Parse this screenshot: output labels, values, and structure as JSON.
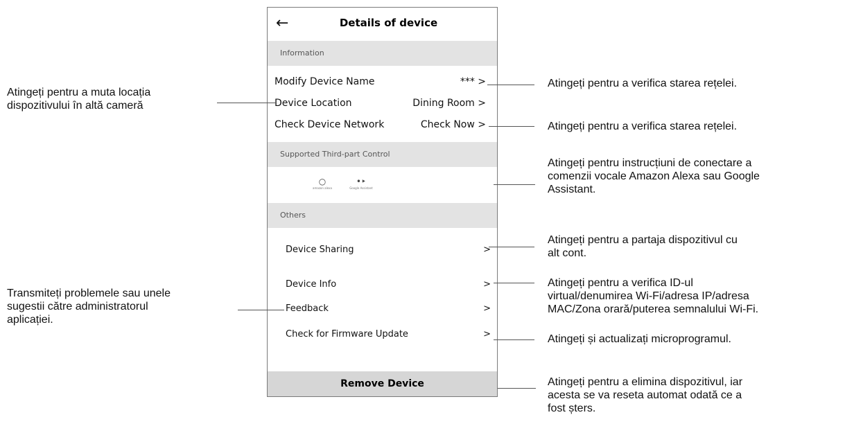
{
  "header": {
    "back_icon": "arrow-left-icon",
    "title": "Details of device"
  },
  "sections": {
    "information": "Information",
    "third_party": "Supported Third-part Control",
    "others": "Others"
  },
  "info_rows": [
    {
      "label": "Modify Device Name",
      "value": "*** >"
    },
    {
      "label": "Device Location",
      "value": "Dining Room >"
    },
    {
      "label": "Check Device Network",
      "value": "Check Now >"
    }
  ],
  "third_party_items": [
    {
      "icon": "amazon-alexa-icon",
      "caption": "amazon alexa"
    },
    {
      "icon": "google-assistant-icon",
      "caption": "Google Assistant"
    }
  ],
  "other_rows": [
    {
      "label": "Device Sharing",
      "chevron": ">"
    },
    {
      "label": "Device Info",
      "chevron": ">"
    },
    {
      "label": "Feedback",
      "chevron": ">"
    },
    {
      "label": "Check for Firmware Update",
      "chevron": ">"
    }
  ],
  "remove_label": "Remove Device",
  "annotations": {
    "left_location": [
      "Atingeți pentru a muta locația",
      "dispozitivului în altă cameră"
    ],
    "left_feedback": [
      "Transmiteți problemele sau unele",
      "sugestii către administratorul",
      "aplicației."
    ],
    "right_name": [
      "Atingeți pentru a verifica starea rețelei."
    ],
    "right_network": [
      "Atingeți pentru a verifica starea rețelei."
    ],
    "right_voice": [
      "Atingeți pentru instrucțiuni de conectare a",
      "comenzii vocale Amazon Alexa sau Google",
      "Assistant."
    ],
    "right_sharing": [
      "Atingeți pentru a partaja dispozitivul cu",
      "alt cont."
    ],
    "right_info": [
      "Atingeți pentru a verifica ID-ul",
      "virtual/denumirea Wi-Fi/adresa IP/adresa",
      "MAC/Zona orară/puterea semnalului Wi-Fi."
    ],
    "right_firmware": [
      "Atingeți și actualizați microprogramul."
    ],
    "right_remove": [
      "Atingeți pentru a elimina dispozitivul, iar",
      "acesta se va reseta automat odată ce a",
      "fost șters."
    ]
  }
}
